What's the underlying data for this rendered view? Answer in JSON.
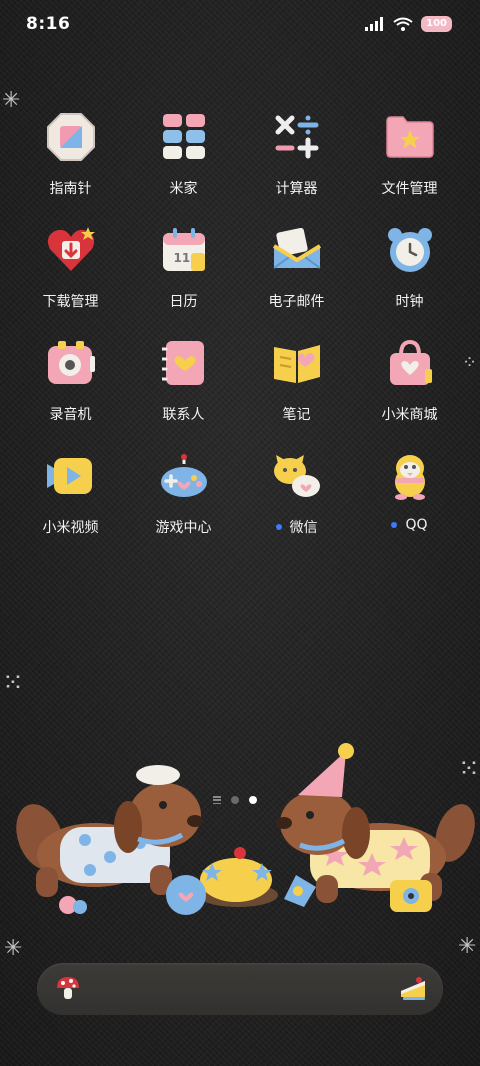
{
  "status_bar": {
    "time": "8:16",
    "battery": "100"
  },
  "apps": [
    {
      "label": "指南针"
    },
    {
      "label": "米家"
    },
    {
      "label": "计算器"
    },
    {
      "label": "文件管理"
    },
    {
      "label": "下载管理"
    },
    {
      "label": "日历"
    },
    {
      "label": "电子邮件"
    },
    {
      "label": "时钟"
    },
    {
      "label": "录音机"
    },
    {
      "label": "联系人"
    },
    {
      "label": "笔记"
    },
    {
      "label": "小米商城"
    },
    {
      "label": "小米视频"
    },
    {
      "label": "游戏中心"
    },
    {
      "label": "微信"
    },
    {
      "label": "QQ"
    }
  ],
  "calendar_icon_day": "11",
  "page_indicator": {
    "pages": 2,
    "active": 2
  },
  "colors": {
    "accent_dot": "#3a7bff",
    "battery": "#f3b8c4"
  }
}
